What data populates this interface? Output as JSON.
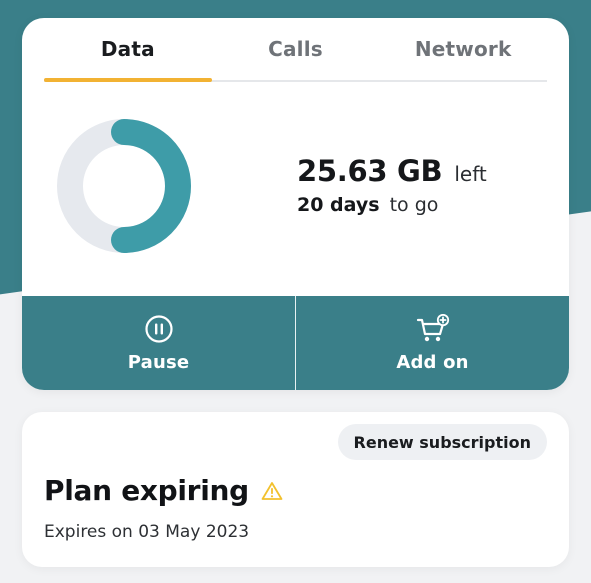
{
  "tabs": [
    {
      "label": "Data",
      "active": true
    },
    {
      "label": "Calls",
      "active": false
    },
    {
      "label": "Network",
      "active": false
    }
  ],
  "usage": {
    "remaining_amount": "25.63 GB",
    "remaining_suffix": "left",
    "days_amount": "20 days",
    "days_suffix": "to go",
    "ring_fraction_remaining": 0.5
  },
  "actions": {
    "pause_label": "Pause",
    "pause_icon": "pause-circle-icon",
    "addon_label": "Add on",
    "addon_icon": "cart-plus-icon"
  },
  "plan": {
    "renew_label": "Renew subscription",
    "title": "Plan expiring",
    "warning_icon": "warning-icon",
    "expiry_text": "Expires on 03 May 2023"
  },
  "colors": {
    "brand_teal": "#3a7f89",
    "ring_fill": "#3e9ca8",
    "ring_track": "#e6e9ee",
    "tab_indicator": "#f2b233",
    "warning": "#f2c12e"
  }
}
